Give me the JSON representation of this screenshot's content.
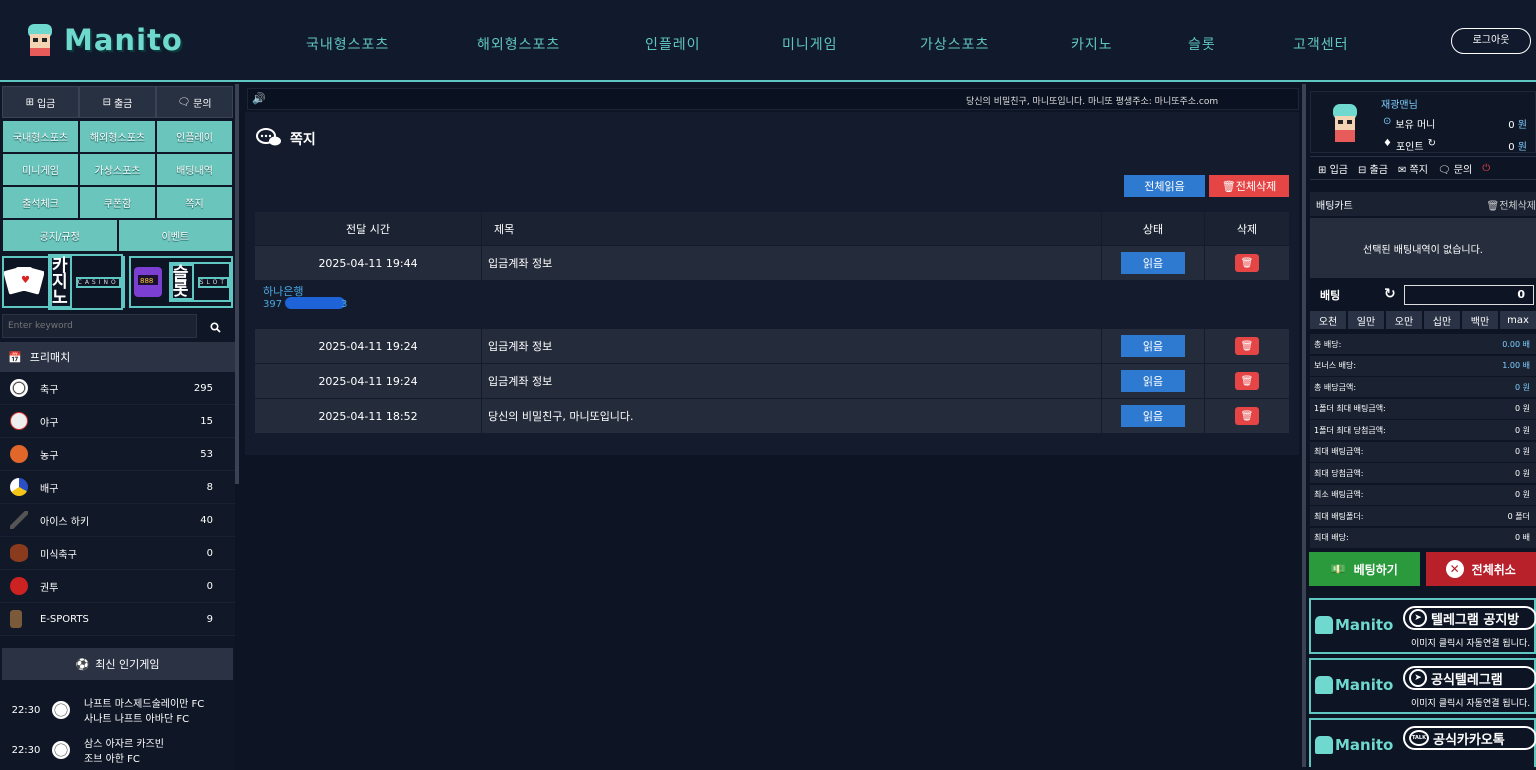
{
  "brand": {
    "logo_text": "Manito"
  },
  "nav": [
    "국내형스포츠",
    "해외형스포츠",
    "인플레이",
    "미니게임",
    "가상스포츠",
    "카지노",
    "슬롯",
    "고객센터"
  ],
  "header": {
    "logout": "로그아웃"
  },
  "left": {
    "account_buttons": [
      "입금",
      "출금",
      "문의"
    ],
    "grid": [
      [
        "국내형스포츠",
        "해외형스포츠",
        "인플레이"
      ],
      [
        "미니게임",
        "가상스포츠",
        "배팅내역"
      ],
      [
        "출석체크",
        "쿠폰함",
        "쪽지"
      ],
      [
        "공지/규정",
        "이벤트"
      ]
    ],
    "banners": [
      {
        "title": "카지노",
        "sub": "CASINO"
      },
      {
        "title": "슬롯",
        "sub": "SLOT"
      }
    ],
    "search_placeholder": "Enter keyword",
    "prematch_label": "프리매치",
    "sports": [
      {
        "name": "축구",
        "count": "295"
      },
      {
        "name": "야구",
        "count": "15"
      },
      {
        "name": "농구",
        "count": "53"
      },
      {
        "name": "배구",
        "count": "8"
      },
      {
        "name": "아이스 하키",
        "count": "40"
      },
      {
        "name": "미식축구",
        "count": "0"
      },
      {
        "name": "권투",
        "count": "0"
      },
      {
        "name": "E-SPORTS",
        "count": "9"
      }
    ],
    "popular_title": "최신 인기게임",
    "popular_games": [
      {
        "time": "22:30",
        "home": "나프트 마스제드술레이만 FC",
        "away": "사나트 나프트 아바단 FC"
      },
      {
        "time": "22:30",
        "home": "삼스 아자르 카즈빈",
        "away": "조브 아한 FC"
      }
    ]
  },
  "ticker": "당신의 비밀친구, 마니또입니다. 마니또 평생주소: 마니또주소.com",
  "messages": {
    "title": "쪽지",
    "read_all": "전체읽음",
    "delete_all": "전체삭제",
    "columns": [
      "전달 시간",
      "제목",
      "상태",
      "삭제"
    ],
    "rows": [
      {
        "time": "2025-04-11 19:44",
        "subject": "입금계좌 정보",
        "status": "읽음"
      },
      {
        "time": "2025-04-11 19:24",
        "subject": "입금계좌 정보",
        "status": "읽음"
      },
      {
        "time": "2025-04-11 19:24",
        "subject": "입금계좌 정보",
        "status": "읽음"
      },
      {
        "time": "2025-04-11 18:52",
        "subject": "당신의 비밀친구, 마니또입니다.",
        "status": "읽음"
      }
    ],
    "detail": {
      "bank": "하나은행",
      "account_prefix": "397",
      "account_suffix": "3"
    }
  },
  "right": {
    "user_name": "재광맨님",
    "money_label": "보유 머니",
    "money_value": "0",
    "money_unit": "원",
    "point_label": "포인트",
    "point_value": "0",
    "point_unit": "원",
    "actions": [
      "입금",
      "출금",
      "쪽지",
      "문의"
    ],
    "slip_title": "배팅카트",
    "slip_delete_all": "전체삭제",
    "slip_empty": "선택된 배팅내역이 없습니다.",
    "bet_label": "배팅",
    "bet_value": "0",
    "chips": [
      "오천",
      "일만",
      "오만",
      "십만",
      "백만",
      "max"
    ],
    "info": [
      {
        "label": "총 배당:",
        "value": "0.00 배",
        "color": true
      },
      {
        "label": "보너스 배당:",
        "value": "1.00 배",
        "color": true
      },
      {
        "label": "총 배당금액:",
        "value": "0 원",
        "color": true
      },
      {
        "label": "1폴더 최대 배팅금액:",
        "value": "0 원",
        "color": false
      },
      {
        "label": "1폴더 최대 당첨금액:",
        "value": "0 원",
        "color": false
      },
      {
        "label": "최대 배팅금액:",
        "value": "0 원",
        "color": false
      },
      {
        "label": "최대 당첨금액:",
        "value": "0 원",
        "color": false
      },
      {
        "label": "최소 배팅금액:",
        "value": "0 원",
        "color": false
      },
      {
        "label": "최대 배팅폴더:",
        "value": "0 폴더",
        "color": false
      },
      {
        "label": "최대 배당:",
        "value": "0 배",
        "color": false
      }
    ],
    "bet_button": "베팅하기",
    "cancel_button": "전체취소",
    "promos": [
      {
        "title": "텔레그램 공지방",
        "sub": "이미지 클릭시 자동연결 됩니다."
      },
      {
        "title": "공식텔레그램",
        "sub": "이미지 클릭시 자동연결 됩니다."
      },
      {
        "title": "공식카카오톡",
        "sub": "이미지 클릭시 자동연결 됩니다."
      }
    ]
  }
}
